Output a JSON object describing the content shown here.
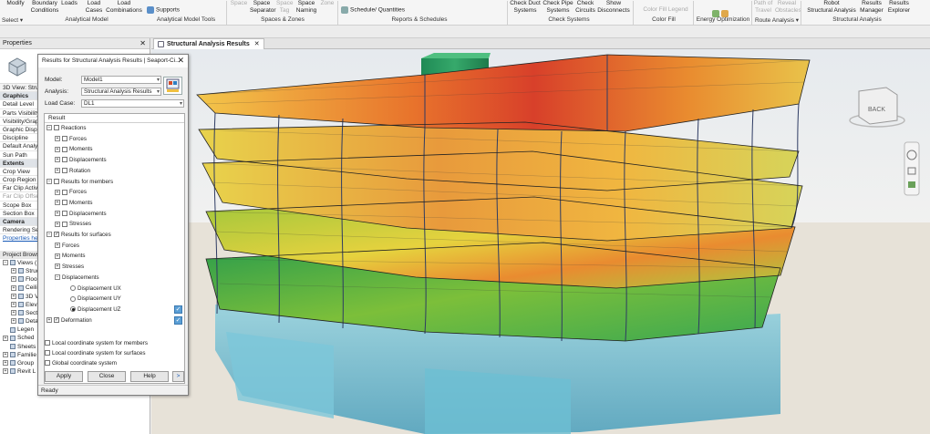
{
  "ribbon": {
    "buttons": [
      {
        "id": "modify",
        "label": "Modify"
      },
      {
        "id": "boundary-conditions",
        "label": "Boundary\nConditions"
      },
      {
        "id": "loads",
        "label": "Loads"
      },
      {
        "id": "load-cases",
        "label": "Load\nCases"
      },
      {
        "id": "load-combinations",
        "label": "Load\nCombinations"
      },
      {
        "id": "supports",
        "label": "Supports"
      },
      {
        "id": "space",
        "label": "Space"
      },
      {
        "id": "space-separator",
        "label": "Space\nSeparator"
      },
      {
        "id": "space-tag",
        "label": "Space\nTag"
      },
      {
        "id": "space-naming",
        "label": "Space\nNaming"
      },
      {
        "id": "zone",
        "label": "Zone"
      },
      {
        "id": "schedule-quantities",
        "label": "Schedule/ Quantities"
      },
      {
        "id": "check-duct-systems",
        "label": "Check Duct\nSystems"
      },
      {
        "id": "check-pipe-systems",
        "label": "Check Pipe\nSystems"
      },
      {
        "id": "check-circuits",
        "label": "Check\nCircuits"
      },
      {
        "id": "show-disconnects",
        "label": "Show\nDisconnects"
      },
      {
        "id": "color-fill-legend",
        "label": "Color Fill  Legend"
      },
      {
        "id": "energy-optimization",
        "label": "Energy Optimization"
      },
      {
        "id": "path-of-travel",
        "label": "Path of\nTravel"
      },
      {
        "id": "reveal-obstacles",
        "label": "Reveal\nObstacles"
      },
      {
        "id": "robot-structural-analysis",
        "label": "Robot\nStructural Analysis"
      },
      {
        "id": "results-manager",
        "label": "Results\nManager"
      },
      {
        "id": "results-explorer",
        "label": "Results\nExplorer"
      }
    ],
    "panels": {
      "select": "Select ▾",
      "analytical_model": "Analytical Model",
      "analytical_model_tools": "Analytical Model Tools",
      "spaces_zones": "Spaces & Zones",
      "reports_schedules": "Reports & Schedules",
      "check_systems": "Check Systems",
      "color_fill": "Color Fill",
      "energy_optimization": "Energy Optimization",
      "route_analysis": "Route Analysis ▾",
      "structural_analysis": "Structural Analysis"
    }
  },
  "properties": {
    "title": "Properties",
    "view_type": "3D View: Stru",
    "rows": [
      {
        "text": "Graphics",
        "cat": true
      },
      {
        "text": "Detail Level"
      },
      {
        "text": "Parts Visibility"
      },
      {
        "text": "Visibility/Grap"
      },
      {
        "text": "Graphic Displ"
      },
      {
        "text": "Discipline"
      },
      {
        "text": "Default Analy"
      },
      {
        "text": "Sun Path"
      },
      {
        "text": "Extents",
        "cat": true
      },
      {
        "text": "Crop View"
      },
      {
        "text": "Crop Region"
      },
      {
        "text": "Far Clip Activ"
      },
      {
        "text": "Far Clip Offse",
        "dim": true
      },
      {
        "text": "Scope Box"
      },
      {
        "text": "Section Box"
      },
      {
        "text": "Camera",
        "cat": true
      },
      {
        "text": "Rendering Se"
      }
    ],
    "help_link": "Properties help",
    "browser_title": "Project Browse",
    "browser_items": [
      {
        "text": "Views (",
        "indent": 0,
        "exp": "⊟"
      },
      {
        "text": "Struct",
        "indent": 1,
        "exp": "⊞"
      },
      {
        "text": "Floor",
        "indent": 1,
        "exp": "⊞"
      },
      {
        "text": "Ceilin",
        "indent": 1,
        "exp": "⊞"
      },
      {
        "text": "3D Vi",
        "indent": 1,
        "exp": "⊞"
      },
      {
        "text": "Elevat",
        "indent": 1,
        "exp": "⊞"
      },
      {
        "text": "Sectio",
        "indent": 1,
        "exp": "⊞"
      },
      {
        "text": "Detail",
        "indent": 1,
        "exp": "⊞"
      },
      {
        "text": "Legen",
        "indent": 0,
        "exp": ""
      },
      {
        "text": "Sched",
        "indent": 0,
        "exp": "⊞"
      },
      {
        "text": "Sheets",
        "indent": 0,
        "exp": ""
      },
      {
        "text": "Familie",
        "indent": 0,
        "exp": "⊞"
      },
      {
        "text": "Group",
        "indent": 0,
        "exp": "⊞"
      },
      {
        "text": "Revit L",
        "indent": 0,
        "exp": "⊞"
      }
    ]
  },
  "view_tab": {
    "label": "Structural Analysis Results"
  },
  "viewcube": {
    "face_label": "BACK"
  },
  "dialog": {
    "title": "Results for Structural Analysis Results | Seaport-Ci...",
    "model_label": "Model:",
    "model_value": "Model1",
    "analysis_label": "Analysis:",
    "analysis_value": "Structural Analysis Results",
    "loadcase_label": "Load Case:",
    "loadcase_value": "DL1",
    "tree_header": "Result",
    "tree": [
      {
        "text": "Reactions",
        "level": 0,
        "exp": "⊟",
        "check": false
      },
      {
        "text": "Forces",
        "level": 1,
        "exp": "⊞",
        "check": false
      },
      {
        "text": "Moments",
        "level": 1,
        "exp": "⊞",
        "check": false
      },
      {
        "text": "Displacements",
        "level": 1,
        "exp": "⊞",
        "check": false
      },
      {
        "text": "Rotation",
        "level": 1,
        "exp": "⊞",
        "check": false
      },
      {
        "text": "Results for members",
        "level": 0,
        "exp": "⊟",
        "check": false
      },
      {
        "text": "Forces",
        "level": 1,
        "exp": "⊞",
        "check": false
      },
      {
        "text": "Moments",
        "level": 1,
        "exp": "⊞",
        "check": false
      },
      {
        "text": "Displacements",
        "level": 1,
        "exp": "⊞",
        "check": false
      },
      {
        "text": "Stresses",
        "level": 1,
        "exp": "⊞",
        "check": false
      },
      {
        "text": "Results for surfaces",
        "level": 0,
        "exp": "⊟",
        "check": true
      },
      {
        "text": "Forces",
        "level": 1,
        "exp": "⊞",
        "nocheck": true
      },
      {
        "text": "Moments",
        "level": 1,
        "exp": "⊞",
        "nocheck": true
      },
      {
        "text": "Stresses",
        "level": 1,
        "exp": "⊞",
        "nocheck": true
      },
      {
        "text": "Displacements",
        "level": 1,
        "exp": "⊟",
        "nocheck": true
      },
      {
        "text": "Displacement UX",
        "level": 2,
        "radio": false
      },
      {
        "text": "Displacement UY",
        "level": 2,
        "radio": false
      },
      {
        "text": "Displacement UZ",
        "level": 2,
        "radio": true,
        "blue": true
      },
      {
        "text": "Deformation",
        "level": 0,
        "exp": "⊞",
        "check": true,
        "blue": true
      }
    ],
    "options": [
      "Local coordinate system for members",
      "Local coordinate system for surfaces",
      "Global coordinate system"
    ],
    "apply": "Apply",
    "close": "Close",
    "help": "Help",
    "more": ">",
    "status": "Ready"
  }
}
